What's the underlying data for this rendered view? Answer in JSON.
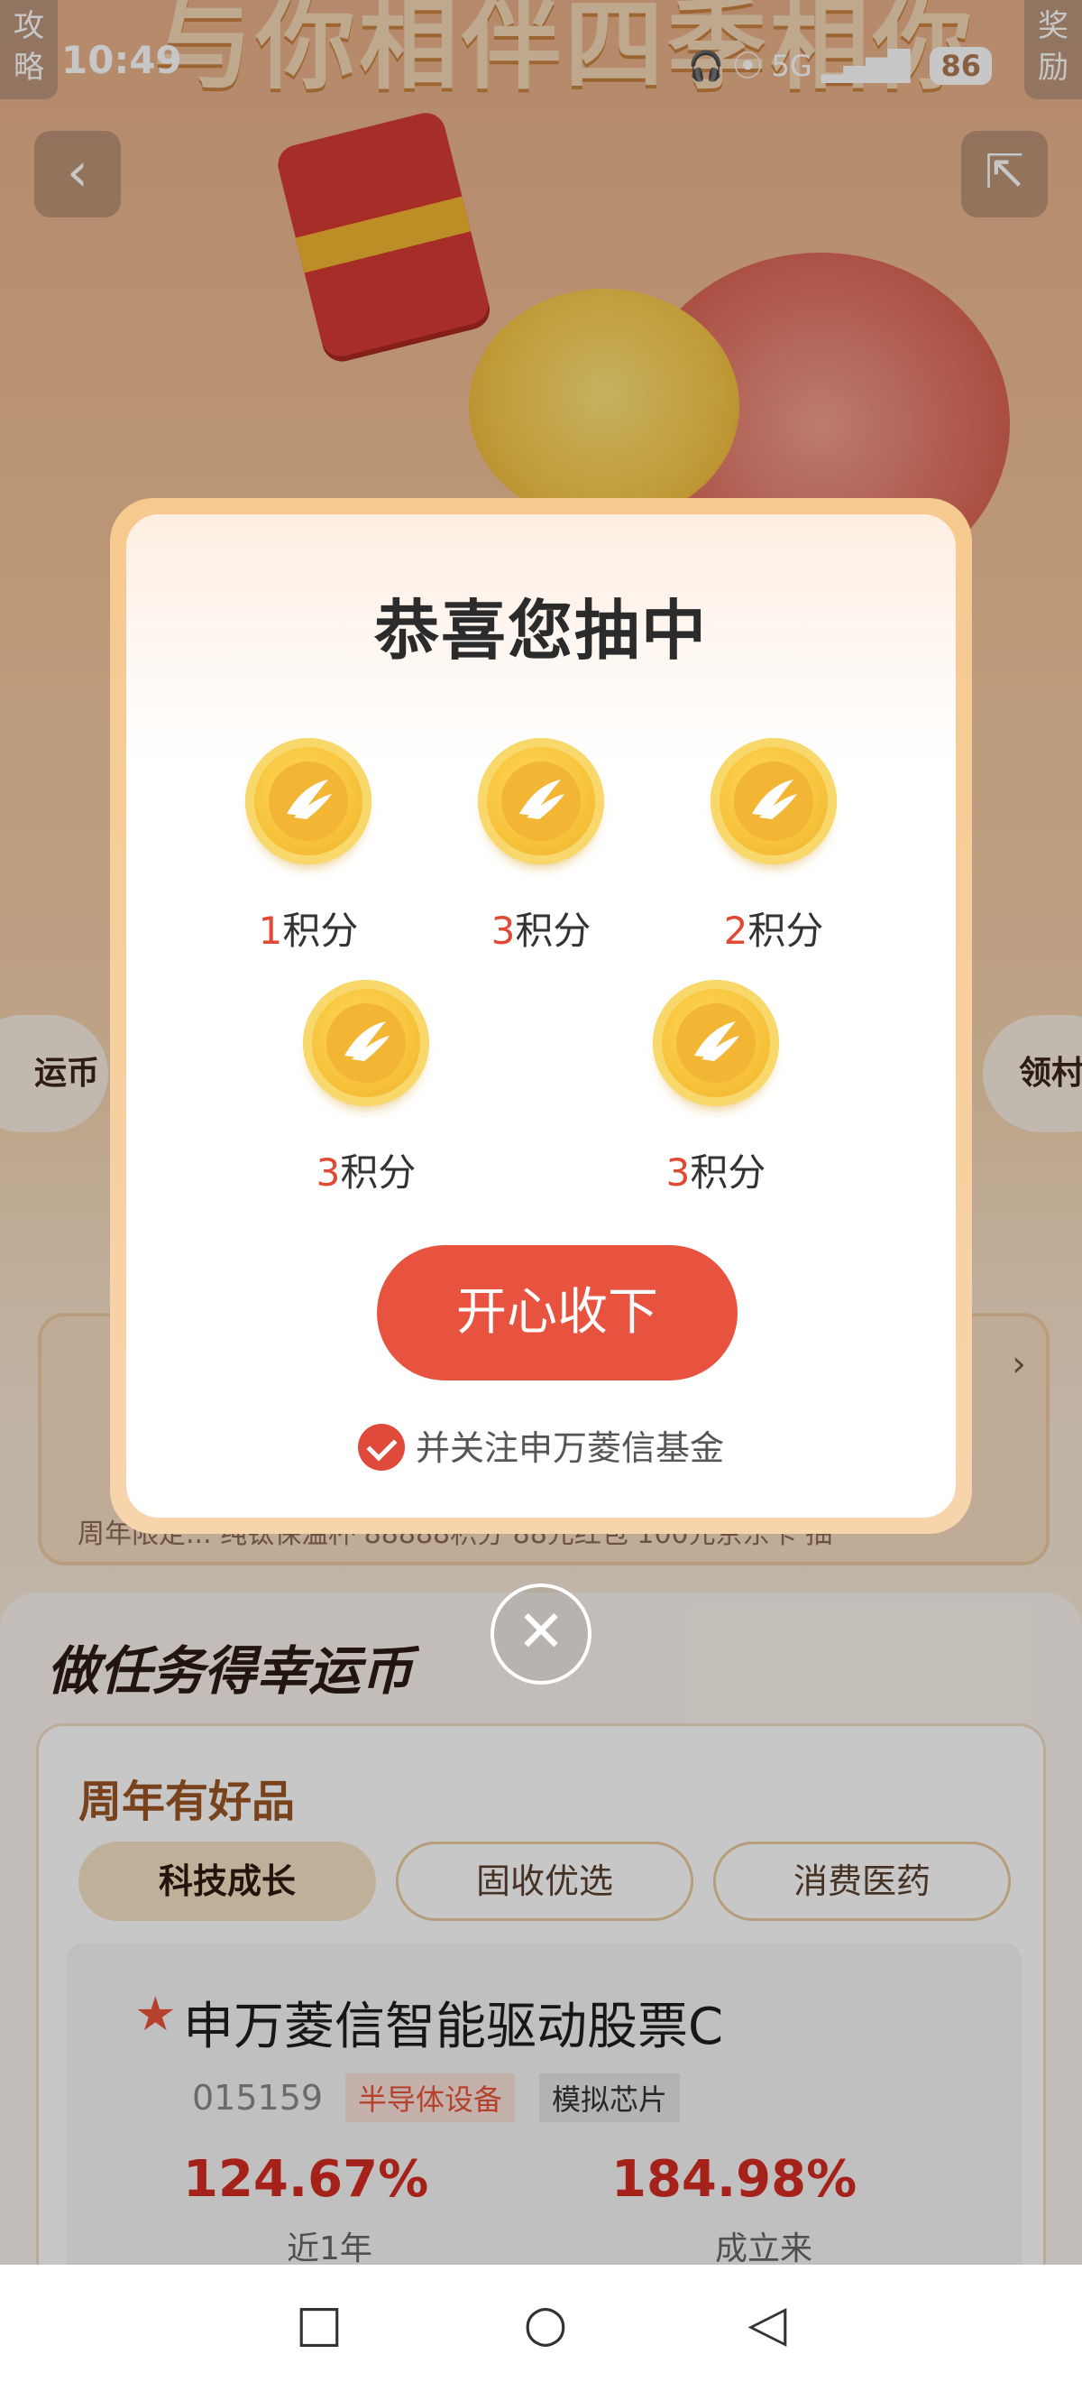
{
  "status_bar": {
    "time": "10:49",
    "network": "5G",
    "battery": "86"
  },
  "banner": {
    "title": "与你相伴四季相你",
    "left_tag": "攻略",
    "right_tag": "奖励"
  },
  "side_bubbles": {
    "left": "运币",
    "right": "领村"
  },
  "prize_strip": {
    "captions": "周年限定...  纯钛保温杯   88888积分    88元红包    100元京东卡   抽"
  },
  "tasks": {
    "title": "做任务得幸运币",
    "goods_title": "周年有好品",
    "tabs": [
      "科技成长",
      "固收优选",
      "消费医药"
    ],
    "fund": {
      "name": "申万菱信智能驱动股票C",
      "code": "015159",
      "tag_primary": "半导体设备",
      "tag_secondary": "模拟芯片",
      "return_1y": "124.67%",
      "return_1y_label": "近1年",
      "return_since": "184.98%",
      "return_since_label": "成立来"
    }
  },
  "modal": {
    "title": "恭喜您抽中",
    "prizes": [
      {
        "amount": "1",
        "unit": "积分"
      },
      {
        "amount": "3",
        "unit": "积分"
      },
      {
        "amount": "2",
        "unit": "积分"
      },
      {
        "amount": "3",
        "unit": "积分"
      },
      {
        "amount": "3",
        "unit": "积分"
      }
    ],
    "confirm_label": "开心收下",
    "follow_label": "并关注申万菱信基金",
    "follow_checked": true
  },
  "colors": {
    "accent": "#e8533f",
    "coin": "#f7c23a",
    "number_red": "#e04a32"
  },
  "icons": {
    "back": "chevron-left-icon",
    "share": "share-icon",
    "close": "close-icon",
    "star": "star-icon",
    "check": "check-circle-icon",
    "coin": "banana-coin-icon"
  }
}
